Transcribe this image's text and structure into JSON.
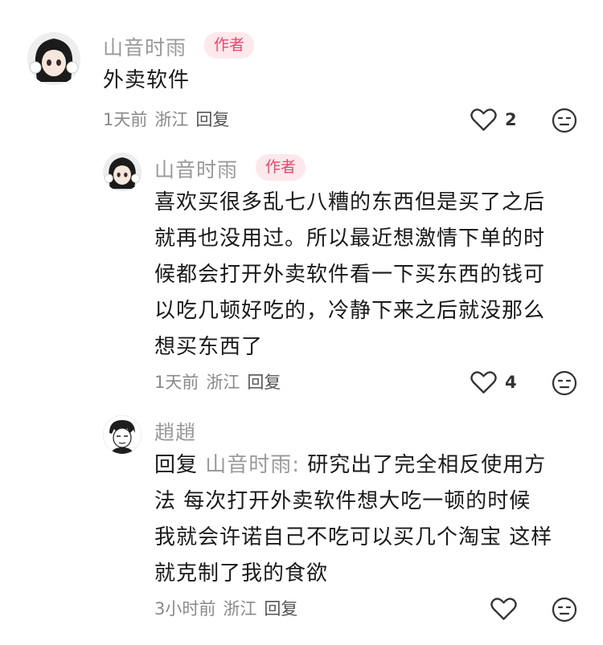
{
  "comments": [
    {
      "username": "山音时雨",
      "badge": "作者",
      "content_lines": [
        "外卖软件"
      ],
      "time": "1天前",
      "location": "浙江",
      "reply_label": "回复",
      "likes": "2"
    },
    {
      "username": "山音时雨",
      "badge": "作者",
      "content_lines": [
        "喜欢买很多乱七八糟的东西但是买了之后",
        "就再也没用过。所以最近想激情下单的时",
        "候都会打开外卖软件看一下买东西的钱可",
        "以吃几顿好吃的，冷静下来之后就没那么",
        "想买东西了"
      ],
      "time": "1天前",
      "location": "浙江",
      "reply_label": "回复",
      "likes": "4"
    },
    {
      "username": "趙趙",
      "reply_prefix": "回复 ",
      "reply_target": "山音时雨:",
      "content_first_line_rest": " 研究出了完全相反使用方",
      "content_lines": [
        "法 每次打开外卖软件想大吃一顿的时候",
        "我就会许诺自己不吃可以买几个淘宝 这样",
        "就克制了我的食欲"
      ],
      "time": "3小时前",
      "location": "浙江",
      "reply_label": "回复",
      "likes": ""
    }
  ],
  "icons": {
    "like": "heart-outline-icon",
    "dislike": "unhappy-face-icon"
  }
}
